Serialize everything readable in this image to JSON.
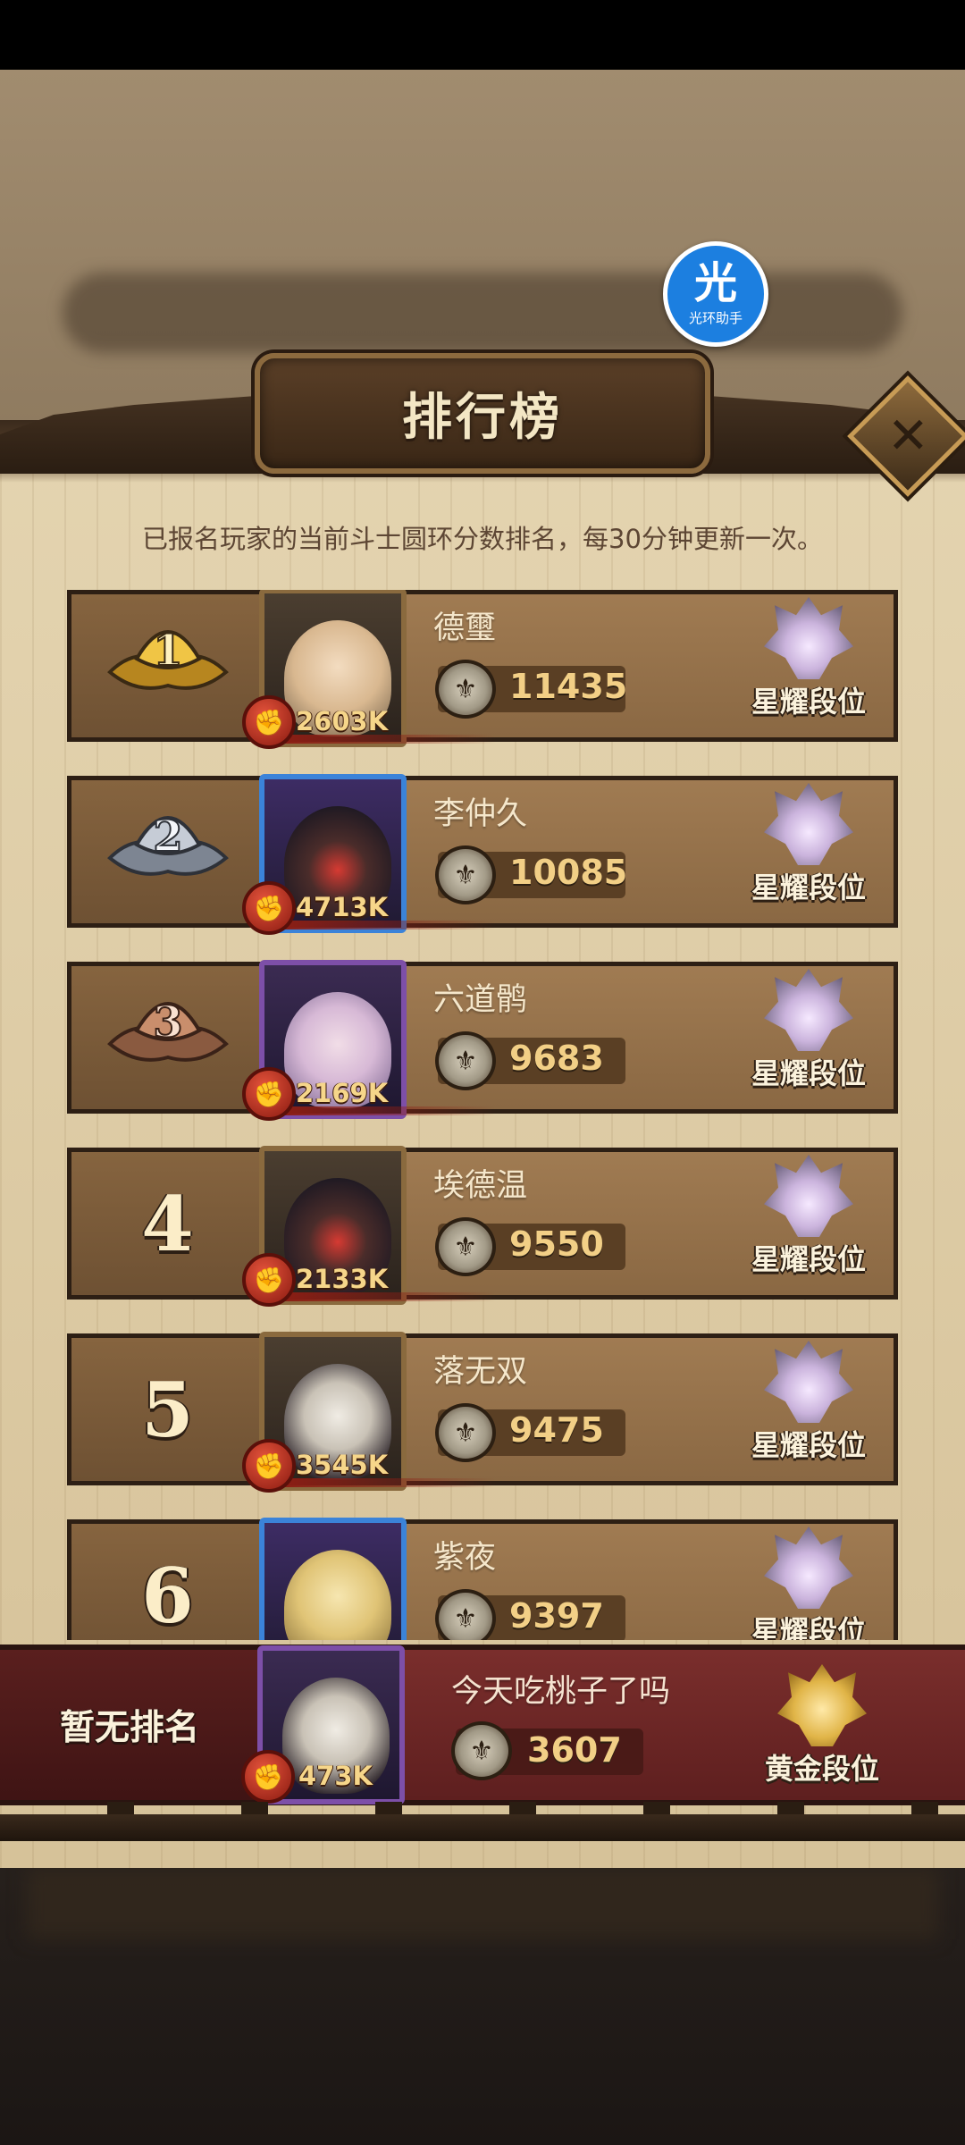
{
  "header": {
    "title": "排行榜",
    "close_icon": "close-icon",
    "assistant_badge": {
      "glyph": "光",
      "label": "光环助手"
    }
  },
  "subtitle": "已报名玩家的当前斗士圆环分数排名，每30分钟更新一次。",
  "rows": [
    {
      "rank": "1",
      "name": "德璽",
      "power": "2603K",
      "score": "11435",
      "tier": "星耀段位",
      "medal_color": "#d9a42a",
      "avatar_frame": "gold"
    },
    {
      "rank": "2",
      "name": "李仲久",
      "power": "4713K",
      "score": "10085",
      "tier": "星耀段位",
      "medal_color": "#aab1bd",
      "avatar_frame": "blue"
    },
    {
      "rank": "3",
      "name": "六道鹘",
      "power": "2169K",
      "score": "9683",
      "tier": "星耀段位",
      "medal_color": "#b37859",
      "avatar_frame": "purple"
    },
    {
      "rank": "4",
      "name": "埃德温",
      "power": "2133K",
      "score": "9550",
      "tier": "星耀段位",
      "avatar_frame": "gold"
    },
    {
      "rank": "5",
      "name": "落无双",
      "power": "3545K",
      "score": "9475",
      "tier": "星耀段位",
      "avatar_frame": "gold"
    },
    {
      "rank": "6",
      "name": "紫夜",
      "power": "",
      "score": "9397",
      "tier": "星耀段位",
      "avatar_frame": "blue"
    }
  ],
  "self": {
    "rank_text": "暂无排名",
    "name": "今天吃桃子了吗",
    "power": "473K",
    "score": "3607",
    "tier": "黄金段位",
    "avatar_frame": "purple"
  },
  "colors": {
    "panel": "#dccaa3",
    "row_fill": "#8a6843",
    "self_row": "#6a2624",
    "score_text": "#f2cf86",
    "power_text": "#f6d68a"
  }
}
